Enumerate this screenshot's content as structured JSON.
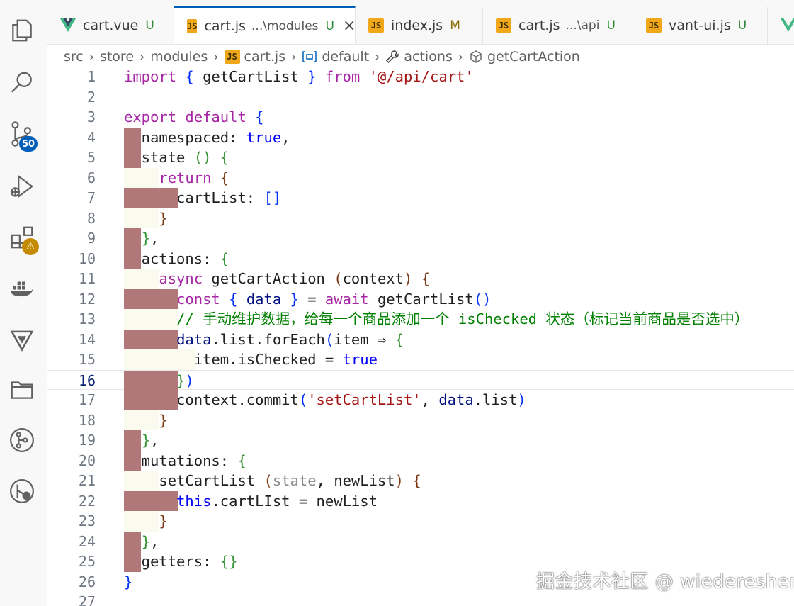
{
  "activity_bar": {
    "items": [
      {
        "name": "explorer-icon"
      },
      {
        "name": "search-icon"
      },
      {
        "name": "source-control-icon",
        "badge": "50"
      },
      {
        "name": "run-debug-icon"
      },
      {
        "name": "extensions-icon",
        "badge": "⚠"
      },
      {
        "name": "docker-icon"
      },
      {
        "name": "vitest-icon"
      },
      {
        "name": "folder-icon"
      },
      {
        "name": "git-graph-icon"
      },
      {
        "name": "git-lens-icon"
      }
    ]
  },
  "tabs": [
    {
      "icon": "vue-icon",
      "name": "cart.vue",
      "hint": "",
      "status": "U",
      "active": false
    },
    {
      "icon": "js-icon",
      "name": "cart.js",
      "hint": "...\\modules",
      "status": "U",
      "active": true,
      "close": "×"
    },
    {
      "icon": "js-icon",
      "name": "index.js",
      "hint": "",
      "status": "M",
      "active": false
    },
    {
      "icon": "js-icon",
      "name": "cart.js",
      "hint": "...\\api",
      "status": "U",
      "active": false
    },
    {
      "icon": "js-icon",
      "name": "vant-ui.js",
      "hint": "",
      "status": "U",
      "active": false
    }
  ],
  "js_label": "JS",
  "breadcrumb": {
    "items": [
      "src",
      "store",
      "modules",
      "cart.js",
      "default",
      "actions",
      "getCartAction"
    ]
  },
  "editor": {
    "line_numbers": [
      "1",
      "2",
      "3",
      "4",
      "5",
      "6",
      "7",
      "8",
      "9",
      "10",
      "11",
      "12",
      "13",
      "14",
      "15",
      "16",
      "17",
      "18",
      "19",
      "20",
      "21",
      "22",
      "23",
      "24",
      "25",
      "26",
      "27"
    ],
    "current_line": "16",
    "lines": [
      [
        [
          "t-kw",
          "import"
        ],
        [
          "t-def",
          " "
        ],
        [
          "t-br",
          "{"
        ],
        [
          "t-def",
          " getCartList "
        ],
        [
          "t-br",
          "}"
        ],
        [
          "t-def",
          " "
        ],
        [
          "t-kw",
          "from"
        ],
        [
          "t-def",
          " "
        ],
        [
          "t-str",
          "'@/api/cart'"
        ]
      ],
      [],
      [
        [
          "t-kw",
          "export"
        ],
        [
          "t-def",
          " "
        ],
        [
          "t-kw",
          "default"
        ],
        [
          "t-def",
          " "
        ],
        [
          "t-br",
          "{"
        ]
      ],
      [
        [
          "t-def",
          "  namespaced: "
        ],
        [
          "t-bool",
          "true"
        ],
        [
          "t-def",
          ","
        ]
      ],
      [
        [
          "t-def",
          "  state "
        ],
        [
          "t-br2",
          "()"
        ],
        [
          "t-def",
          " "
        ],
        [
          "t-br2",
          "{"
        ]
      ],
      [
        [
          "t-def",
          "    "
        ],
        [
          "t-kw",
          "return"
        ],
        [
          "t-def",
          " "
        ],
        [
          "t-br3",
          "{"
        ]
      ],
      [
        [
          "t-def",
          "      cartList: "
        ],
        [
          "t-br",
          "[]"
        ]
      ],
      [
        [
          "t-def",
          "    "
        ],
        [
          "t-br3",
          "}"
        ]
      ],
      [
        [
          "t-def",
          "  "
        ],
        [
          "t-br2",
          "}"
        ],
        [
          "t-def",
          ","
        ]
      ],
      [
        [
          "t-def",
          "  actions: "
        ],
        [
          "t-br2",
          "{"
        ]
      ],
      [
        [
          "t-def",
          "    "
        ],
        [
          "t-kw",
          "async"
        ],
        [
          "t-def",
          " getCartAction "
        ],
        [
          "t-br3",
          "("
        ],
        [
          "t-def",
          "context"
        ],
        [
          "t-br3",
          ")"
        ],
        [
          "t-def",
          " "
        ],
        [
          "t-br3",
          "{"
        ]
      ],
      [
        [
          "t-def",
          "      "
        ],
        [
          "t-kw",
          "const"
        ],
        [
          "t-def",
          " "
        ],
        [
          "t-br",
          "{"
        ],
        [
          "t-def",
          " "
        ],
        [
          "t-var",
          "data"
        ],
        [
          "t-def",
          " "
        ],
        [
          "t-br",
          "}"
        ],
        [
          "t-def",
          " = "
        ],
        [
          "t-kw",
          "await"
        ],
        [
          "t-def",
          " getCartList"
        ],
        [
          "t-br",
          "()"
        ]
      ],
      [
        [
          "t-cm",
          "      // 手动维护数据，给每一个商品添加一个 isChecked 状态（标记当前商品是否选中）"
        ]
      ],
      [
        [
          "t-def",
          "      "
        ],
        [
          "t-var",
          "data"
        ],
        [
          "t-def",
          ".list.forEach"
        ],
        [
          "t-br",
          "("
        ],
        [
          "t-def",
          "item ⇒ "
        ],
        [
          "t-br2",
          "{"
        ]
      ],
      [
        [
          "t-def",
          "        item.isChecked = "
        ],
        [
          "t-bool",
          "true"
        ]
      ],
      [
        [
          "t-def",
          "      "
        ],
        [
          "t-br2",
          "}"
        ],
        [
          "t-br",
          ")"
        ]
      ],
      [
        [
          "t-def",
          "      context.commit"
        ],
        [
          "t-br",
          "("
        ],
        [
          "t-str",
          "'setCartList'"
        ],
        [
          "t-def",
          ", "
        ],
        [
          "t-var",
          "data"
        ],
        [
          "t-def",
          ".list"
        ],
        [
          "t-br",
          ")"
        ]
      ],
      [
        [
          "t-def",
          "    "
        ],
        [
          "t-br3",
          "}"
        ]
      ],
      [
        [
          "t-def",
          "  "
        ],
        [
          "t-br2",
          "}"
        ],
        [
          "t-def",
          ","
        ]
      ],
      [
        [
          "t-def",
          "  mutations: "
        ],
        [
          "t-br2",
          "{"
        ]
      ],
      [
        [
          "t-def",
          "    setCartList "
        ],
        [
          "t-br3",
          "("
        ],
        [
          "t-param",
          "state"
        ],
        [
          "t-def",
          ", newList"
        ],
        [
          "t-br3",
          ")"
        ],
        [
          "t-def",
          " "
        ],
        [
          "t-br3",
          "{"
        ]
      ],
      [
        [
          "t-def",
          "      "
        ],
        [
          "t-this",
          "this"
        ],
        [
          "t-def",
          ".cartLIst = newList"
        ]
      ],
      [
        [
          "t-def",
          "    "
        ],
        [
          "t-br3",
          "}"
        ]
      ],
      [
        [
          "t-def",
          "  "
        ],
        [
          "t-br2",
          "}"
        ],
        [
          "t-def",
          ","
        ]
      ],
      [
        [
          "t-def",
          "  getters: "
        ],
        [
          "t-br2",
          "{}"
        ]
      ],
      [
        [
          "t-br",
          "}"
        ]
      ],
      []
    ]
  },
  "watermark": "掘金技术社区 @ wiedereshen"
}
